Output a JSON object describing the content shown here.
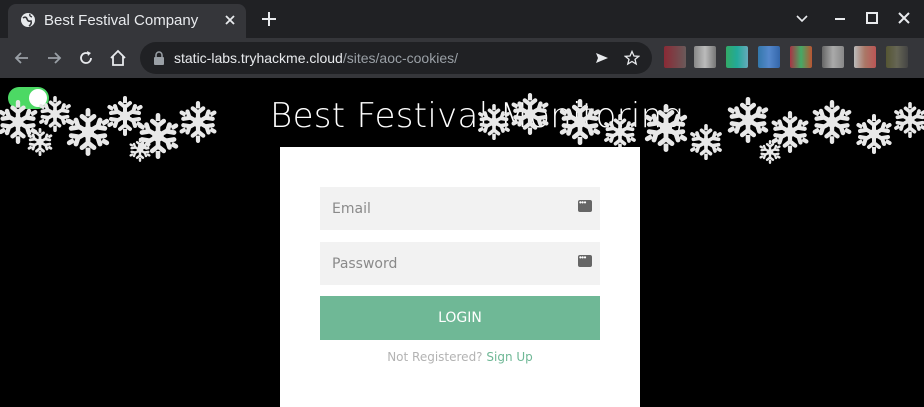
{
  "browser": {
    "tab_title": "Best Festival Company",
    "url_host": "static-labs.tryhackme.cloud",
    "url_path": "/sites/aoc-cookies/"
  },
  "page": {
    "heading": "Best Festival Monitoring",
    "toggle_on": true
  },
  "login": {
    "email_placeholder": "Email",
    "password_placeholder": "Password",
    "login_label": "LOGIN",
    "not_registered": "Not Registered?",
    "signup_label": "Sign Up"
  },
  "colors": {
    "accent": "#6fb896",
    "toggle": "#4cd964"
  }
}
